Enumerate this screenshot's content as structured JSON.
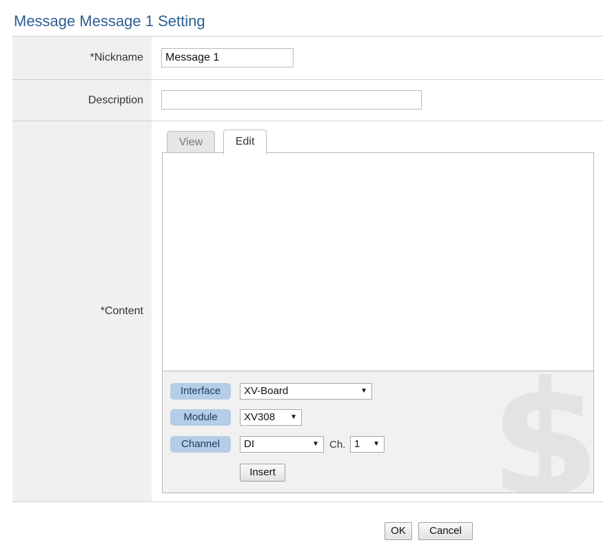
{
  "page": {
    "title": "Message Message 1 Setting"
  },
  "form": {
    "nickname": {
      "label": "*Nickname",
      "value": "Message 1"
    },
    "description": {
      "label": "Description",
      "value": ""
    },
    "content": {
      "label": "*Content"
    }
  },
  "tabs": [
    {
      "label": "View",
      "active": false
    },
    {
      "label": "Edit",
      "active": true
    }
  ],
  "editor": {
    "value": ""
  },
  "insert_panel": {
    "interface": {
      "label": "Interface",
      "selected": "XV-Board"
    },
    "module": {
      "label": "Module",
      "selected": "XV308"
    },
    "channel": {
      "label": "Channel",
      "selected": "DI",
      "ch_label": "Ch.",
      "ch_selected": "1"
    },
    "insert_button": "Insert",
    "watermark_icon": "dollar-icon"
  },
  "footer": {
    "ok_label": "OK",
    "cancel_label": "Cancel"
  },
  "colors": {
    "title": "#2e5f93",
    "pill_bg": "#b5cde6",
    "label_bg": "#f0f0f0"
  }
}
